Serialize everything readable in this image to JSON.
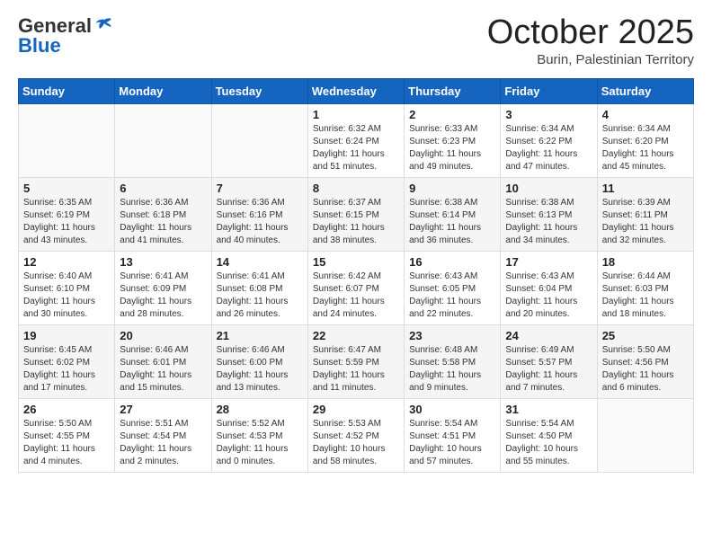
{
  "header": {
    "logo_line1": "General",
    "logo_line2": "Blue",
    "month": "October 2025",
    "location": "Burin, Palestinian Territory"
  },
  "weekdays": [
    "Sunday",
    "Monday",
    "Tuesday",
    "Wednesday",
    "Thursday",
    "Friday",
    "Saturday"
  ],
  "weeks": [
    [
      {
        "day": "",
        "info": ""
      },
      {
        "day": "",
        "info": ""
      },
      {
        "day": "",
        "info": ""
      },
      {
        "day": "1",
        "info": "Sunrise: 6:32 AM\nSunset: 6:24 PM\nDaylight: 11 hours\nand 51 minutes."
      },
      {
        "day": "2",
        "info": "Sunrise: 6:33 AM\nSunset: 6:23 PM\nDaylight: 11 hours\nand 49 minutes."
      },
      {
        "day": "3",
        "info": "Sunrise: 6:34 AM\nSunset: 6:22 PM\nDaylight: 11 hours\nand 47 minutes."
      },
      {
        "day": "4",
        "info": "Sunrise: 6:34 AM\nSunset: 6:20 PM\nDaylight: 11 hours\nand 45 minutes."
      }
    ],
    [
      {
        "day": "5",
        "info": "Sunrise: 6:35 AM\nSunset: 6:19 PM\nDaylight: 11 hours\nand 43 minutes."
      },
      {
        "day": "6",
        "info": "Sunrise: 6:36 AM\nSunset: 6:18 PM\nDaylight: 11 hours\nand 41 minutes."
      },
      {
        "day": "7",
        "info": "Sunrise: 6:36 AM\nSunset: 6:16 PM\nDaylight: 11 hours\nand 40 minutes."
      },
      {
        "day": "8",
        "info": "Sunrise: 6:37 AM\nSunset: 6:15 PM\nDaylight: 11 hours\nand 38 minutes."
      },
      {
        "day": "9",
        "info": "Sunrise: 6:38 AM\nSunset: 6:14 PM\nDaylight: 11 hours\nand 36 minutes."
      },
      {
        "day": "10",
        "info": "Sunrise: 6:38 AM\nSunset: 6:13 PM\nDaylight: 11 hours\nand 34 minutes."
      },
      {
        "day": "11",
        "info": "Sunrise: 6:39 AM\nSunset: 6:11 PM\nDaylight: 11 hours\nand 32 minutes."
      }
    ],
    [
      {
        "day": "12",
        "info": "Sunrise: 6:40 AM\nSunset: 6:10 PM\nDaylight: 11 hours\nand 30 minutes."
      },
      {
        "day": "13",
        "info": "Sunrise: 6:41 AM\nSunset: 6:09 PM\nDaylight: 11 hours\nand 28 minutes."
      },
      {
        "day": "14",
        "info": "Sunrise: 6:41 AM\nSunset: 6:08 PM\nDaylight: 11 hours\nand 26 minutes."
      },
      {
        "day": "15",
        "info": "Sunrise: 6:42 AM\nSunset: 6:07 PM\nDaylight: 11 hours\nand 24 minutes."
      },
      {
        "day": "16",
        "info": "Sunrise: 6:43 AM\nSunset: 6:05 PM\nDaylight: 11 hours\nand 22 minutes."
      },
      {
        "day": "17",
        "info": "Sunrise: 6:43 AM\nSunset: 6:04 PM\nDaylight: 11 hours\nand 20 minutes."
      },
      {
        "day": "18",
        "info": "Sunrise: 6:44 AM\nSunset: 6:03 PM\nDaylight: 11 hours\nand 18 minutes."
      }
    ],
    [
      {
        "day": "19",
        "info": "Sunrise: 6:45 AM\nSunset: 6:02 PM\nDaylight: 11 hours\nand 17 minutes."
      },
      {
        "day": "20",
        "info": "Sunrise: 6:46 AM\nSunset: 6:01 PM\nDaylight: 11 hours\nand 15 minutes."
      },
      {
        "day": "21",
        "info": "Sunrise: 6:46 AM\nSunset: 6:00 PM\nDaylight: 11 hours\nand 13 minutes."
      },
      {
        "day": "22",
        "info": "Sunrise: 6:47 AM\nSunset: 5:59 PM\nDaylight: 11 hours\nand 11 minutes."
      },
      {
        "day": "23",
        "info": "Sunrise: 6:48 AM\nSunset: 5:58 PM\nDaylight: 11 hours\nand 9 minutes."
      },
      {
        "day": "24",
        "info": "Sunrise: 6:49 AM\nSunset: 5:57 PM\nDaylight: 11 hours\nand 7 minutes."
      },
      {
        "day": "25",
        "info": "Sunrise: 5:50 AM\nSunset: 4:56 PM\nDaylight: 11 hours\nand 6 minutes."
      }
    ],
    [
      {
        "day": "26",
        "info": "Sunrise: 5:50 AM\nSunset: 4:55 PM\nDaylight: 11 hours\nand 4 minutes."
      },
      {
        "day": "27",
        "info": "Sunrise: 5:51 AM\nSunset: 4:54 PM\nDaylight: 11 hours\nand 2 minutes."
      },
      {
        "day": "28",
        "info": "Sunrise: 5:52 AM\nSunset: 4:53 PM\nDaylight: 11 hours\nand 0 minutes."
      },
      {
        "day": "29",
        "info": "Sunrise: 5:53 AM\nSunset: 4:52 PM\nDaylight: 10 hours\nand 58 minutes."
      },
      {
        "day": "30",
        "info": "Sunrise: 5:54 AM\nSunset: 4:51 PM\nDaylight: 10 hours\nand 57 minutes."
      },
      {
        "day": "31",
        "info": "Sunrise: 5:54 AM\nSunset: 4:50 PM\nDaylight: 10 hours\nand 55 minutes."
      },
      {
        "day": "",
        "info": ""
      }
    ]
  ]
}
